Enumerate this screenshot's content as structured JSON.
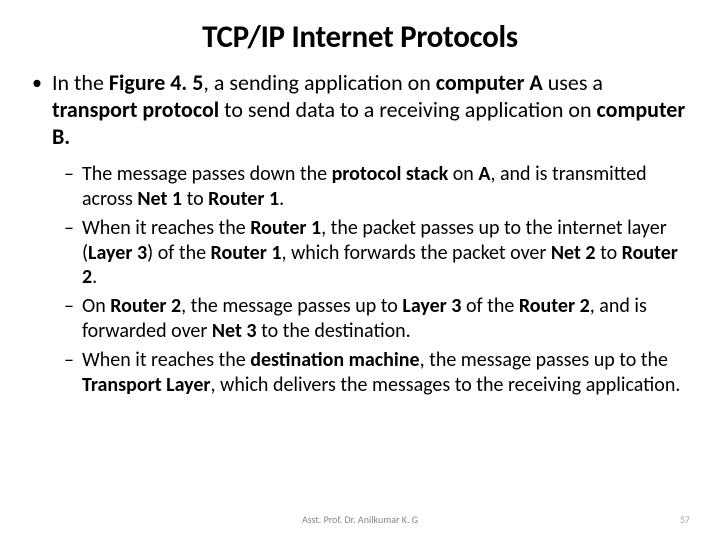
{
  "title": "TCP/IP Internet Protocols",
  "top_bullet": {
    "pre1": "In the ",
    "b1": "Figure 4. 5",
    "mid1": ", a sending application on ",
    "b2": "computer A",
    "mid2": " uses a ",
    "b3": "transport protocol",
    "mid3": " to send data to a receiving application on ",
    "b4": "computer B.",
    "post": ""
  },
  "sub": [
    {
      "pre1": "The message passes down the ",
      "b1": "protocol stack",
      "mid1": " on ",
      "b2": "A",
      "mid2": ", and is transmitted across ",
      "b3": "Net 1",
      "mid3": " to ",
      "b4": "Router 1",
      "mid4": ".",
      "b5": "",
      "mid5": "",
      "b6": "",
      "mid6": ""
    },
    {
      "pre1": "When it reaches the ",
      "b1": "Router 1",
      "mid1": ", the packet passes up to the internet layer (",
      "b2": "Layer 3",
      "mid2": ") of the ",
      "b3": "Router 1",
      "mid3": ", which forwards the packet over ",
      "b4": "Net 2",
      "mid4": " to ",
      "b5": "Router 2",
      "mid5": ".",
      "b6": "",
      "mid6": ""
    },
    {
      "pre1": "On ",
      "b1": "Router 2",
      "mid1": ", the message passes up to ",
      "b2": "Layer 3",
      "mid2": " of the ",
      "b3": "Router 2",
      "mid3": ", and is forwarded over ",
      "b4": "Net 3",
      "mid4": " to the destination.",
      "b5": "",
      "mid5": "",
      "b6": "",
      "mid6": ""
    },
    {
      "pre1": "When it reaches the ",
      "b1": "destination machine",
      "mid1": ", the message passes up to the ",
      "b2": "Transport Layer",
      "mid2": ", which delivers the messages to the receiving application.",
      "b3": "",
      "mid3": "",
      "b4": "",
      "mid4": "",
      "b5": "",
      "mid5": "",
      "b6": "",
      "mid6": ""
    }
  ],
  "footer": "Asst. Prof. Dr. Anilkumar K. G",
  "page": "57"
}
